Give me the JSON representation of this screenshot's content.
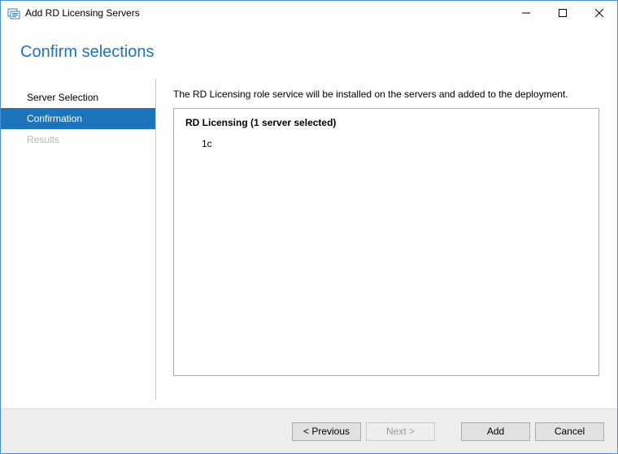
{
  "window": {
    "title": "Add RD Licensing Servers"
  },
  "heading": "Confirm selections",
  "sidebar": {
    "items": [
      {
        "label": "Server Selection",
        "state": "normal"
      },
      {
        "label": "Confirmation",
        "state": "active"
      },
      {
        "label": "Results",
        "state": "disabled"
      }
    ]
  },
  "main": {
    "description": "The RD Licensing role service will be installed on the servers and added to the deployment.",
    "box": {
      "heading": "RD Licensing  (1 server selected)",
      "servers": [
        "1c"
      ]
    }
  },
  "footer": {
    "previous": "< Previous",
    "next": "Next >",
    "add": "Add",
    "cancel": "Cancel"
  }
}
